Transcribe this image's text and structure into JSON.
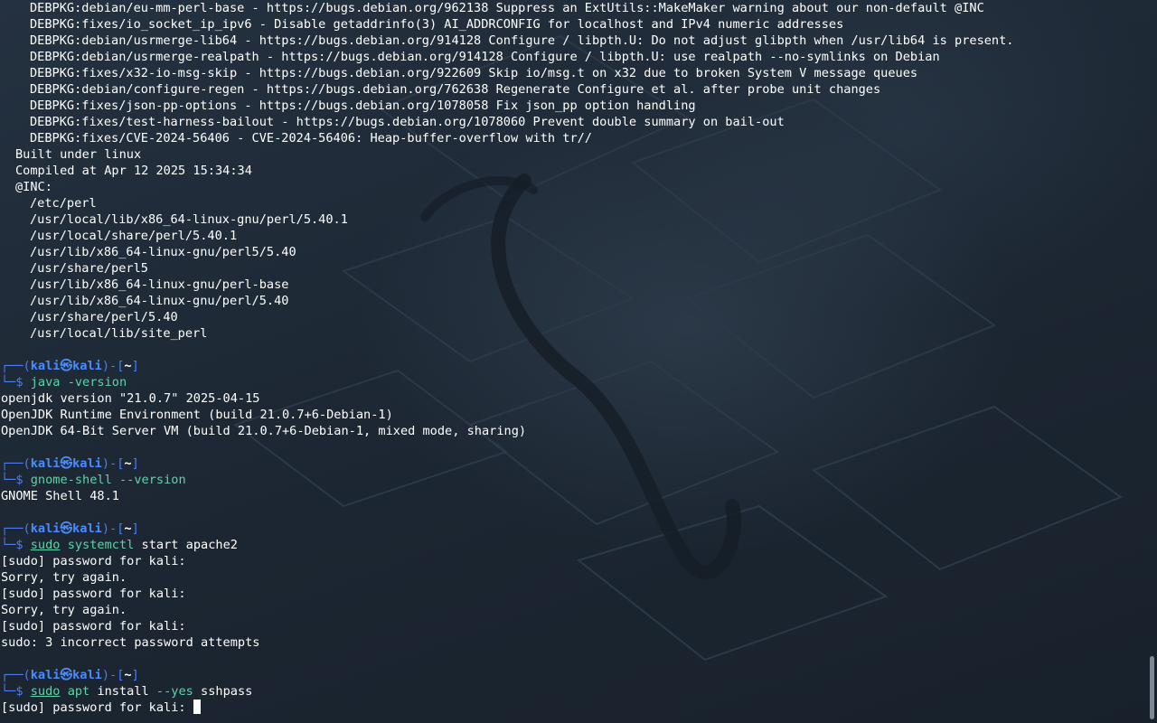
{
  "prompt": {
    "top": "┌──(",
    "user": "kali",
    "at": "㉿",
    "host": "kali",
    "mid": ")-[",
    "cwd": "~",
    "close": "]",
    "bottom": "└─",
    "dollar": "$"
  },
  "perl_patches": [
    "DEBPKG:debian/eu-mm-perl-base - https://bugs.debian.org/962138 Suppress an ExtUtils::MakeMaker warning about our non-default @INC",
    "DEBPKG:fixes/io_socket_ip_ipv6 - Disable getaddrinfo(3) AI_ADDRCONFIG for localhost and IPv4 numeric addresses",
    "DEBPKG:debian/usrmerge-lib64 - https://bugs.debian.org/914128 Configure / libpth.U: Do not adjust glibpth when /usr/lib64 is present.",
    "DEBPKG:debian/usrmerge-realpath - https://bugs.debian.org/914128 Configure / libpth.U: use realpath --no-symlinks on Debian",
    "DEBPKG:fixes/x32-io-msg-skip - https://bugs.debian.org/922609 Skip io/msg.t on x32 due to broken System V message queues",
    "DEBPKG:debian/configure-regen - https://bugs.debian.org/762638 Regenerate Configure et al. after probe unit changes",
    "DEBPKG:fixes/json-pp-options - https://bugs.debian.org/1078058 Fix json_pp option handling",
    "DEBPKG:fixes/test-harness-bailout - https://bugs.debian.org/1078060 Prevent double summary on bail-out",
    "DEBPKG:fixes/CVE-2024-56406 - CVE-2024-56406: Heap-buffer-overflow with tr//"
  ],
  "perl_build": {
    "built": "Built under linux",
    "compiled": "Compiled at Apr 12 2025 15:34:34",
    "inc_label": "@INC:",
    "inc_paths": [
      "/etc/perl",
      "/usr/local/lib/x86_64-linux-gnu/perl/5.40.1",
      "/usr/local/share/perl/5.40.1",
      "/usr/lib/x86_64-linux-gnu/perl5/5.40",
      "/usr/share/perl5",
      "/usr/lib/x86_64-linux-gnu/perl-base",
      "/usr/lib/x86_64-linux-gnu/perl/5.40",
      "/usr/share/perl/5.40",
      "/usr/local/lib/site_perl"
    ]
  },
  "cmd_java": {
    "program": "java",
    "args": "-version",
    "output": [
      "openjdk version \"21.0.7\" 2025-04-15",
      "OpenJDK Runtime Environment (build 21.0.7+6-Debian-1)",
      "OpenJDK 64-Bit Server VM (build 21.0.7+6-Debian-1, mixed mode, sharing)"
    ]
  },
  "cmd_gnome": {
    "program": "gnome-shell",
    "args": "--version",
    "output": [
      "GNOME Shell 48.1"
    ]
  },
  "cmd_apache": {
    "sudo": "sudo",
    "program": "systemctl",
    "args": "start apache2",
    "output": [
      "[sudo] password for kali:",
      "Sorry, try again.",
      "[sudo] password for kali:",
      "Sorry, try again.",
      "[sudo] password for kali:",
      "sudo: 3 incorrect password attempts"
    ]
  },
  "cmd_apt": {
    "sudo": "sudo",
    "program": "apt",
    "arg1": "install",
    "opt": "--yes",
    "arg2": "sshpass",
    "output": "[sudo] password for kali: "
  }
}
